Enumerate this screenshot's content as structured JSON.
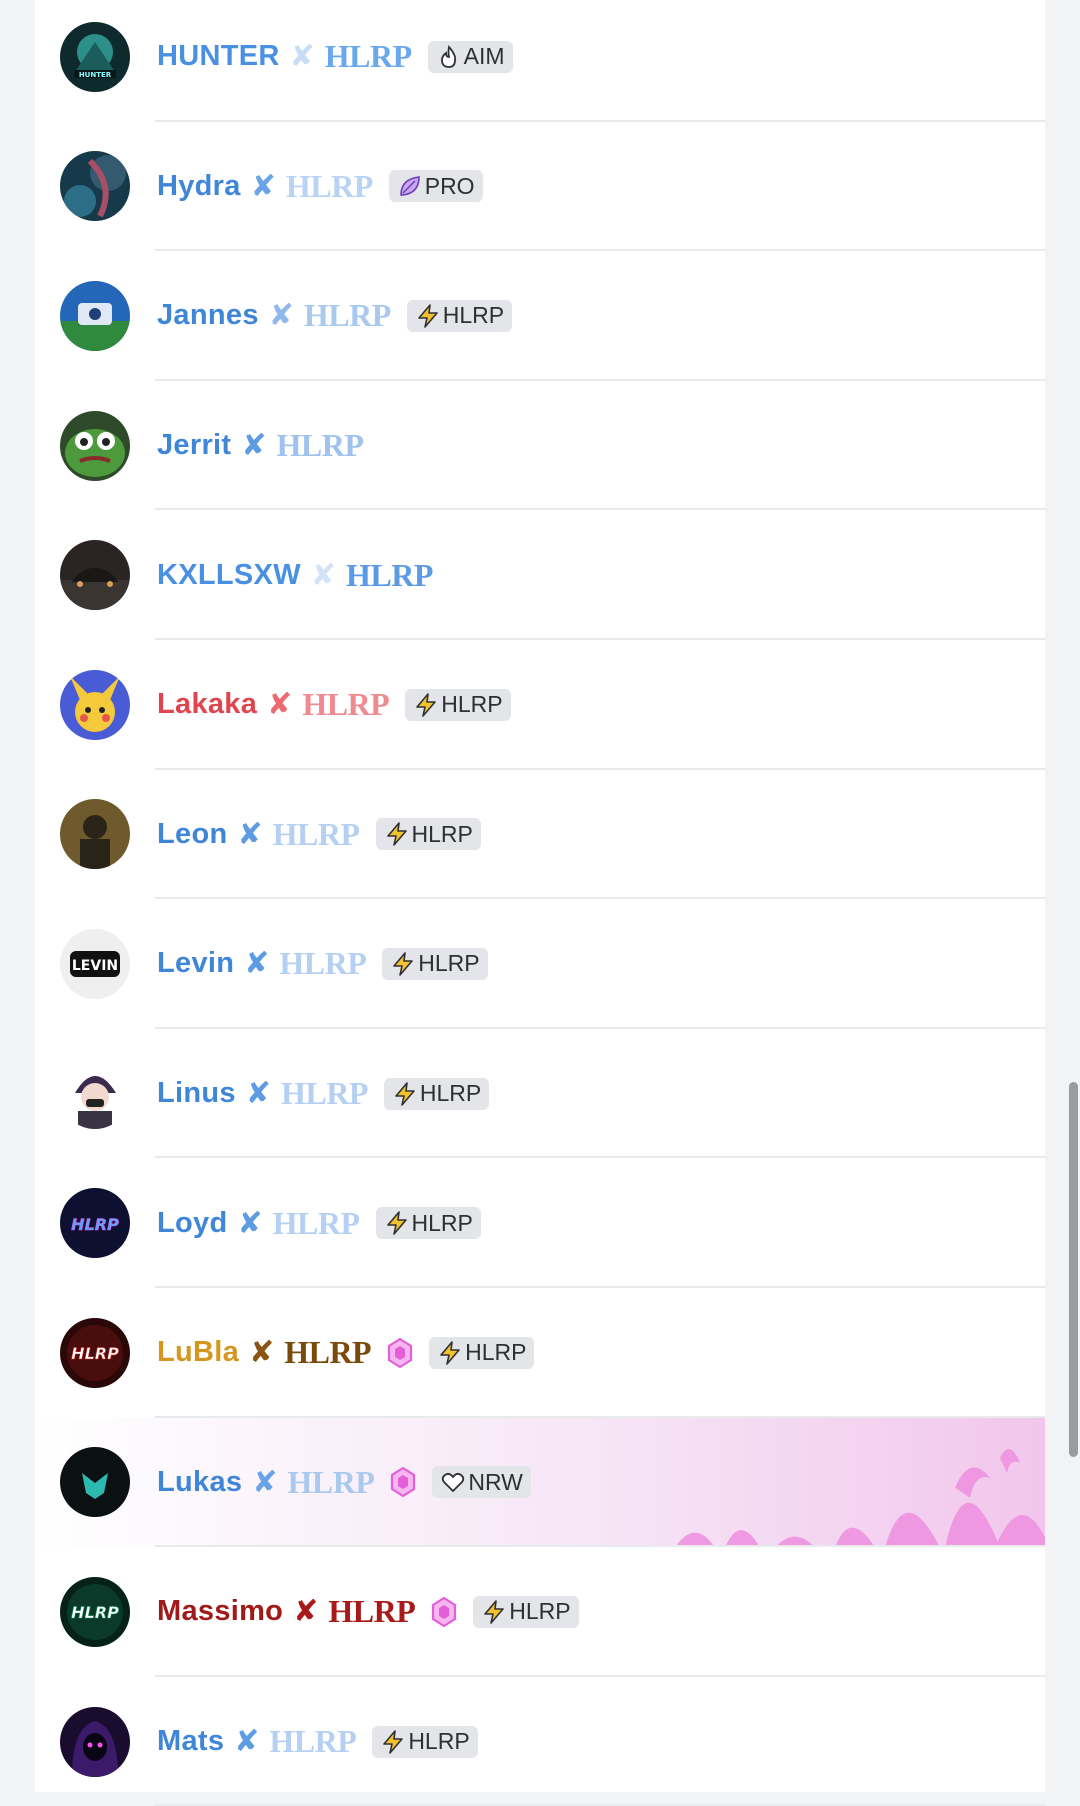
{
  "members": [
    {
      "name": "HUNTER",
      "tag": "HLRP",
      "separator": "✘",
      "badge": {
        "icon": "flame-icon",
        "label": "AIM"
      },
      "booster": false,
      "avatar": "hunter-avatar",
      "name_color": "#4a90e2",
      "tag_color": "#6aa8ee",
      "cross_color": "#c7dcf5"
    },
    {
      "name": "Hydra",
      "tag": "HLRP",
      "separator": "✘",
      "badge": {
        "icon": "leaf-icon",
        "label": "PRO"
      },
      "booster": false,
      "avatar": "hydra-avatar",
      "name_color": "#3f86d8",
      "tag_color": "#b8d3f3",
      "cross_color": "#6aa4e6"
    },
    {
      "name": "Jannes",
      "tag": "HLRP",
      "separator": "✘",
      "badge": {
        "icon": "lightning-icon",
        "label": "HLRP"
      },
      "booster": false,
      "avatar": "jannes-avatar",
      "name_color": "#3f86d8",
      "tag_color": "#a9c9ef",
      "cross_color": "#8fb9ec"
    },
    {
      "name": "Jerrit",
      "tag": "HLRP",
      "separator": "✘",
      "badge": null,
      "booster": false,
      "avatar": "frog-avatar",
      "name_color": "#3f86d8",
      "tag_color": "#9fc2ee",
      "cross_color": "#5d9be3"
    },
    {
      "name": "KXLLSXW",
      "tag": "HLRP",
      "separator": "✘",
      "badge": null,
      "booster": false,
      "avatar": "car-avatar",
      "name_color": "#4a90e2",
      "tag_color": "#5b9ae6",
      "cross_color": "#d3e3f7"
    },
    {
      "name": "Lakaka",
      "tag": "HLRP",
      "separator": "✘",
      "badge": {
        "icon": "lightning-icon",
        "label": "HLRP"
      },
      "booster": false,
      "avatar": "pikachu-avatar",
      "name_color": "#e0454f",
      "tag_color": "#ef8a90",
      "cross_color": "#ec6a72"
    },
    {
      "name": "Leon",
      "tag": "HLRP",
      "separator": "✘",
      "badge": {
        "icon": "lightning-icon",
        "label": "HLRP"
      },
      "booster": false,
      "avatar": "soldier-avatar",
      "name_color": "#3f86d8",
      "tag_color": "#b5d0f2",
      "cross_color": "#5d9be3"
    },
    {
      "name": "Levin",
      "tag": "HLRP",
      "separator": "✘",
      "badge": {
        "icon": "lightning-icon",
        "label": "HLRP"
      },
      "booster": false,
      "avatar": "levin-logo-avatar",
      "avatar_text": "LEVIN",
      "name_color": "#3f86d8",
      "tag_color": "#b5d0f2",
      "cross_color": "#5d9be3"
    },
    {
      "name": "Linus",
      "tag": "HLRP",
      "separator": "✘",
      "badge": {
        "icon": "lightning-icon",
        "label": "HLRP"
      },
      "booster": false,
      "avatar": "anime-avatar",
      "name_color": "#3f86d8",
      "tag_color": "#b5d0f2",
      "cross_color": "#5d9be3"
    },
    {
      "name": "Loyd",
      "tag": "HLRP",
      "separator": "✘",
      "badge": {
        "icon": "lightning-icon",
        "label": "HLRP"
      },
      "booster": false,
      "avatar": "hlrp-neon-avatar",
      "avatar_text": "HLRP",
      "name_color": "#3f86d8",
      "tag_color": "#b5d0f2",
      "cross_color": "#5d9be3"
    },
    {
      "name": "LuBla",
      "tag": "HLRP",
      "separator": "✘",
      "badge": {
        "icon": "lightning-icon",
        "label": "HLRP"
      },
      "booster": true,
      "avatar": "hlrp-red-avatar",
      "avatar_text": "HLRP",
      "name_color": "#d4961e",
      "tag_color": "#7a4a0a",
      "cross_color": "#8a5512"
    },
    {
      "name": "Lukas",
      "tag": "HLRP",
      "separator": "✘",
      "badge": {
        "icon": "heart-icon",
        "label": "NRW"
      },
      "booster": true,
      "avatar": "bat-avatar",
      "highlight": true,
      "name_color": "#3f86d8",
      "tag_color": "#a9c9ef",
      "cross_color": "#6aa4e6"
    },
    {
      "name": "Massimo",
      "tag": "HLRP",
      "separator": "✘",
      "badge": {
        "icon": "lightning-icon",
        "label": "HLRP"
      },
      "booster": true,
      "avatar": "hlrp-green-avatar",
      "avatar_text": "HLRP",
      "name_color": "#a01a1a",
      "tag_color": "#a81a1a",
      "cross_color": "#a81a1a"
    },
    {
      "name": "Mats",
      "tag": "HLRP",
      "separator": "✘",
      "badge": {
        "icon": "lightning-icon",
        "label": "HLRP"
      },
      "booster": false,
      "avatar": "hooded-avatar",
      "name_color": "#3f86d8",
      "tag_color": "#b5d0f2",
      "cross_color": "#5d9be3"
    }
  ]
}
